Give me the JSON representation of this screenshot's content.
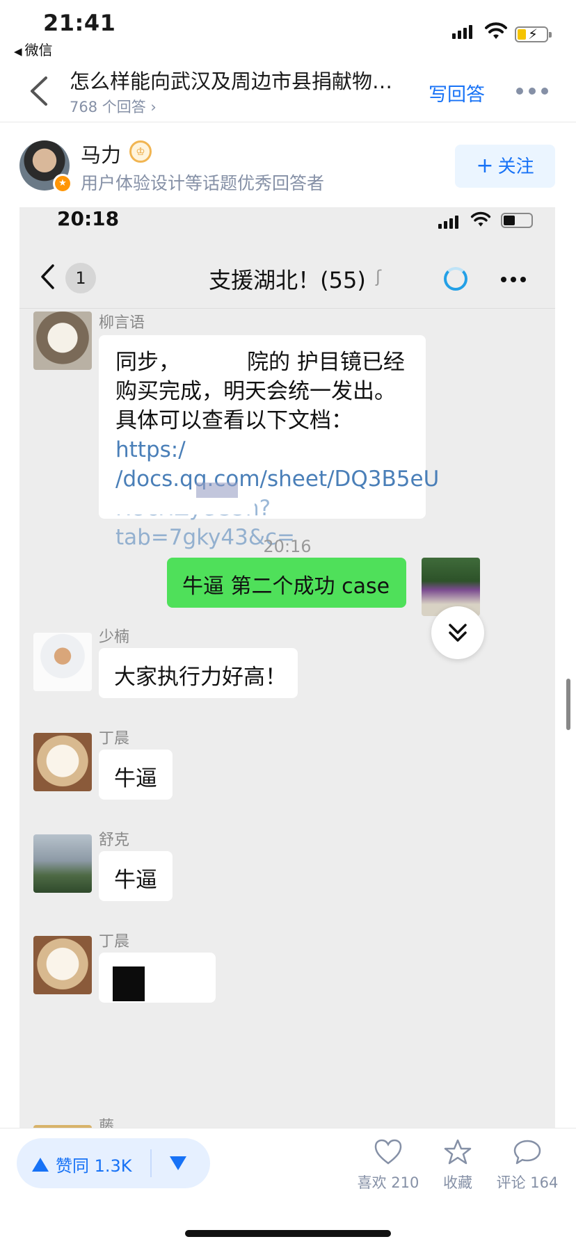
{
  "status": {
    "time": "21:41",
    "back_app": "微信"
  },
  "question": {
    "title": "怎么样能向武汉及周边市县捐献物…",
    "answer_count": "768 个回答 ›",
    "write_answer": "写回答"
  },
  "author": {
    "name": "马力",
    "description": "用户体验设计等话题优秀回答者",
    "follow_label": "关注"
  },
  "inner": {
    "time": "20:18",
    "chat": {
      "unread_count": "1",
      "title": "支援湖北！(55)"
    },
    "messages": [
      {
        "sender": "柳言语",
        "lines": [
          "同步，",
          "院的 护目镜已经",
          "购买完成，明天会统一发出。",
          "具体可以查看以下文档："
        ],
        "link_lines": [
          "https:/",
          "/docs.qq.com/sheet/DQ3B5eU",
          "RUcHZyeG5h?tab=7gky43&c="
        ]
      },
      {
        "timestamp": "20:16"
      },
      {
        "self": true,
        "text": "牛逼 第二个成功 case"
      },
      {
        "sender": "少楠",
        "text": "大家执行力好高！"
      },
      {
        "sender": "丁晨",
        "text": "牛逼"
      },
      {
        "sender": "舒克",
        "text": "牛逼"
      },
      {
        "sender": "丁晨"
      },
      {
        "sender": "藤"
      }
    ]
  },
  "bottom": {
    "vote_label": "赞同 1.3K",
    "like_label": "喜欢 210",
    "collect_label": "收藏",
    "comment_label": "评论 164"
  },
  "colors": {
    "accent": "#1772f6",
    "wechat_green": "#4fe05a",
    "muted": "#8590a6"
  }
}
